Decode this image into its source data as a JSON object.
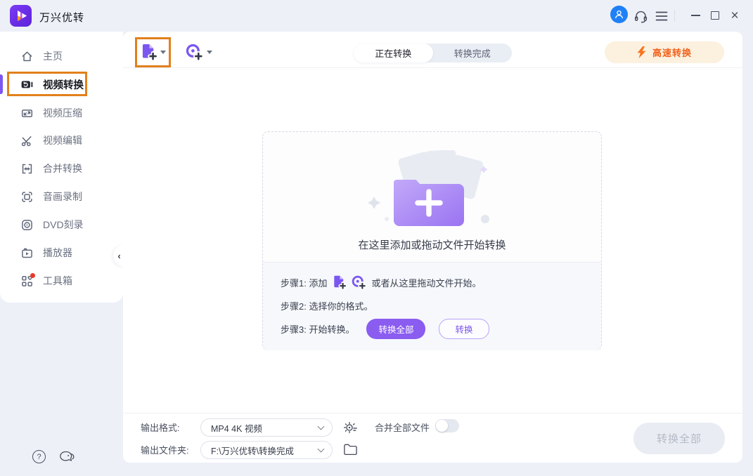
{
  "window": {
    "title": "万兴优转"
  },
  "sidebar": {
    "items": [
      {
        "label": "主页"
      },
      {
        "label": "视频转换",
        "active": true
      },
      {
        "label": "视频压缩"
      },
      {
        "label": "视频编辑"
      },
      {
        "label": "合并转换"
      },
      {
        "label": "音画录制"
      },
      {
        "label": "DVD刻录"
      },
      {
        "label": "播放器"
      },
      {
        "label": "工具箱",
        "badge": true
      }
    ]
  },
  "toolbar": {
    "tabs": [
      {
        "label": "正在转换",
        "active": true
      },
      {
        "label": "转换完成",
        "active": false
      }
    ],
    "speed_button_label": "高速转换"
  },
  "dropzone": {
    "title": "在这里添加或拖动文件开始转换",
    "step1_prefix": "步骤1: 添加",
    "step1_suffix": "或者从这里拖动文件开始。",
    "step2": "步骤2: 选择你的格式。",
    "step3_prefix": "步骤3: 开始转换。",
    "convert_all_button": "转换全部",
    "convert_button": "转换"
  },
  "footer": {
    "output_format_label": "输出格式:",
    "output_format_value": "MP4 4K 视频",
    "output_folder_label": "输出文件夹:",
    "output_folder_value": "F:\\万兴优转\\转换完成",
    "merge_all_label": "合并全部文件",
    "convert_all_label": "转换全部"
  },
  "icons": {
    "logo": "purple-play-logo",
    "titlebar": [
      "user-avatar-icon",
      "headset-icon",
      "menu-icon",
      "minimize-icon",
      "maximize-icon",
      "close-icon"
    ],
    "sidebar": [
      "home-icon",
      "video-convert-icon",
      "video-compress-icon",
      "scissors-icon",
      "merge-icon",
      "record-icon",
      "dvd-icon",
      "player-icon",
      "toolbox-icon"
    ],
    "toolbar": [
      "add-file-icon",
      "add-disc-icon",
      "lightning-icon"
    ],
    "footer": [
      "format-settings-gear-icon",
      "folder-icon"
    ],
    "misc": [
      "question-icon",
      "feedback-icon",
      "collapse-arrow-icon",
      "folder-plus-illustration"
    ]
  },
  "colors": {
    "accent_purple": "#7b57f0",
    "annotation_orange": "#e2801c",
    "speed_orange": "#f2611a",
    "avatar_blue": "#1f80f6",
    "badge_red": "#e8392b",
    "window_bg": "#edf0f7"
  }
}
